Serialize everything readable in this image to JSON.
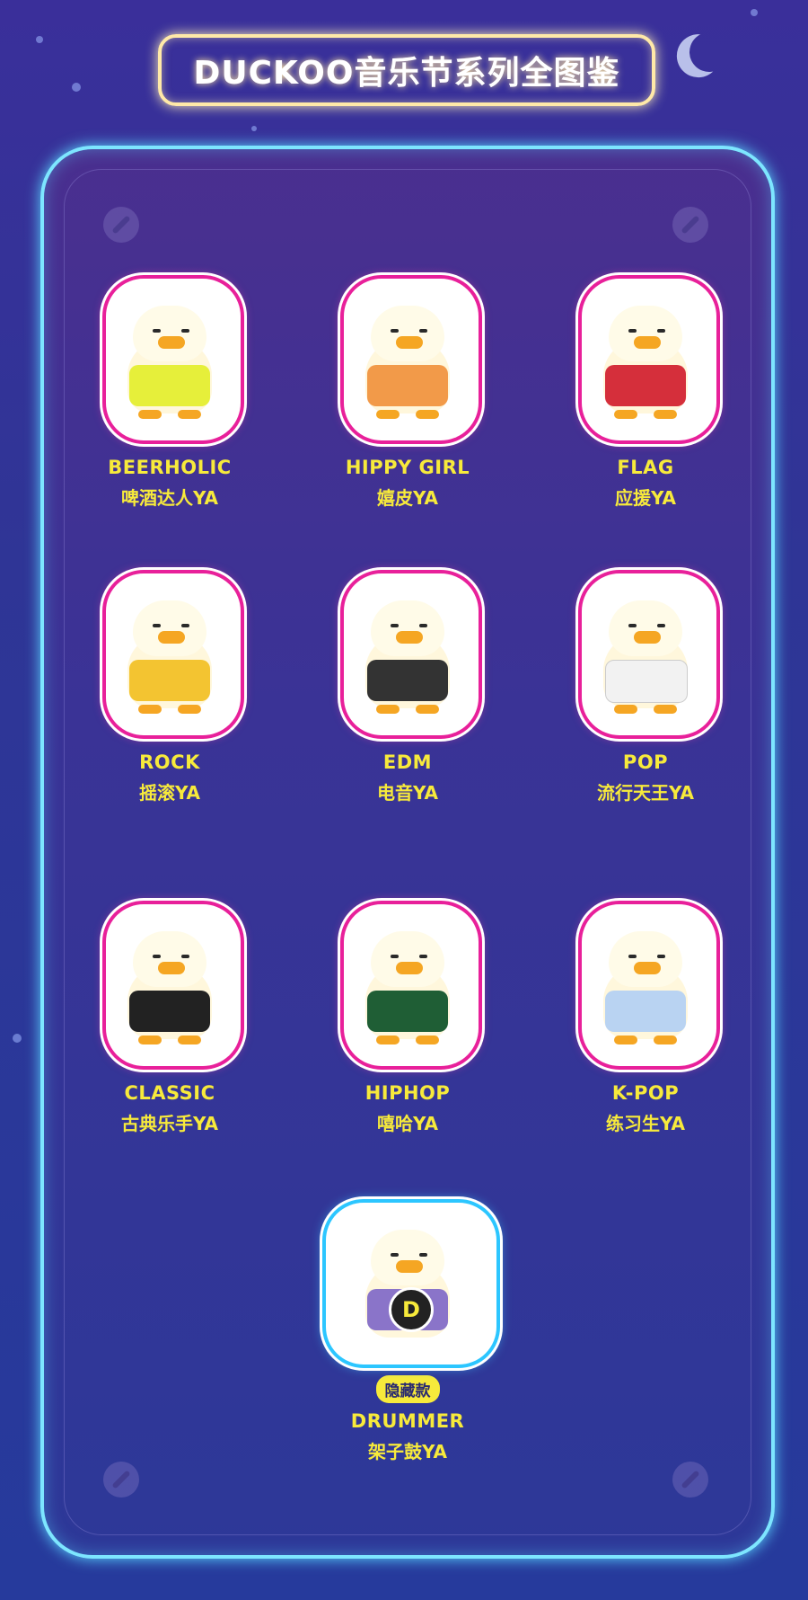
{
  "title": "DUCKOO音乐节系列全图鉴",
  "items": [
    {
      "en": "BEERHOLIC",
      "cn": "啤酒达人YA",
      "color": "#e6ef3a"
    },
    {
      "en": "HIPPY GIRL",
      "cn": "嬉皮YA",
      "color": "#f29a49"
    },
    {
      "en": "FLAG",
      "cn": "应援YA",
      "color": "#d52f3b"
    },
    {
      "en": "ROCK",
      "cn": "摇滚YA",
      "color": "#f3c431"
    },
    {
      "en": "EDM",
      "cn": "电音YA",
      "color": "#333333"
    },
    {
      "en": "POP",
      "cn": "流行天王YA",
      "color": "#f2f2f2"
    },
    {
      "en": "CLASSIC",
      "cn": "古典乐手YA",
      "color": "#222222"
    },
    {
      "en": "HIPHOP",
      "cn": "嘻哈YA",
      "color": "#1f5e35"
    },
    {
      "en": "K-POP",
      "cn": "练习生YA",
      "color": "#b9d3f2"
    }
  ],
  "hidden": {
    "badge": "隐藏款",
    "en": "DRUMMER",
    "cn": "架子鼓YA",
    "logo": "D"
  }
}
